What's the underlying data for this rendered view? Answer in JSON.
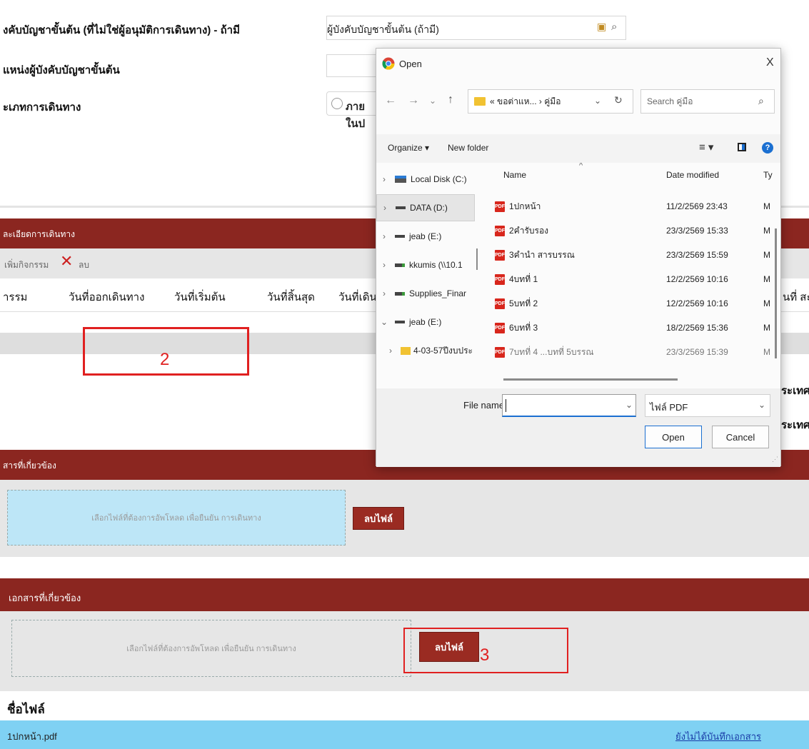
{
  "form": {
    "row1_label": "งคับบัญชาขั้นต้น (ที่ไม่ใช่ผู้อนุมัติการเดินทาง) - ถ้ามี",
    "row1_field": "ผู้บังคับบัญชาขั้นต้น (ถ้ามี)",
    "row2_label": "แหน่งผู้บังคับบัญชาขั้นต้น",
    "row3_label": "ะเภทการเดินทาง",
    "row3_radio": "ภายในป"
  },
  "trip": {
    "header": "ละเอียดการเดินทาง",
    "add_label": "เพิ่มกิจกรรม",
    "delete_label": "ลบ",
    "columns": [
      "ารรม",
      "วันที่ออกเดินทาง",
      "วันที่เริ่มต้น",
      "วันที่สิ้นสุด",
      "วันที่เดินท",
      "นที่ สะ"
    ],
    "right_text_1": "ระเทศ",
    "right_text_2": "ระเทศ"
  },
  "docs1": {
    "header": "สารที่เกี่ยวข้อง",
    "dropzone": "เลือกไฟล์ที่ต้องการอัพโหลด เพื่อยืนยัน การเดินทาง",
    "delete_button": "ลบไฟล์"
  },
  "docs2": {
    "header": "เอกสารที่เกี่ยวข้อง",
    "dropzone": "เลือกไฟล์ที่ต้องการอัพโหลด เพื่อยืนยัน การเดินทาง",
    "delete_button": "ลบไฟล์",
    "file_header": "ชื่อไฟล์",
    "file_name": "1ปกหน้า.pdf",
    "file_status": "ยังไม่ได้บันทึกเอกสาร"
  },
  "annotations": {
    "two": "2",
    "three": "3"
  },
  "dialog": {
    "title": "Open",
    "close": "X",
    "address": "« ขอต่าแห... › คู่มือ",
    "search_placeholder": "Search คู่มือ",
    "organize": "Organize ▾",
    "new_folder": "New folder",
    "nav_items": [
      {
        "label": "Local Disk (C:)",
        "arrow": "›"
      },
      {
        "label": "DATA (D:)",
        "arrow": "›"
      },
      {
        "label": "jeab (E:)",
        "arrow": "›"
      },
      {
        "label": "kkumis (\\\\10.1",
        "arrow": "›"
      },
      {
        "label": "Supplies_Finar",
        "arrow": "›"
      },
      {
        "label": "jeab (E:)",
        "arrow": "⌄"
      },
      {
        "label": "4-03-57ปีงบประ",
        "arrow": "›"
      }
    ],
    "col_name": "Name",
    "col_date": "Date modified",
    "col_type": "Ty",
    "files": [
      {
        "name": "1ปกหน้า",
        "date": "11/2/2569 23:43",
        "type": "M"
      },
      {
        "name": "2คำรับรอง",
        "date": "23/3/2569 15:33",
        "type": "M"
      },
      {
        "name": "3คำนำ สารบรรณ",
        "date": "23/3/2569 15:59",
        "type": "M"
      },
      {
        "name": "4บทที่ 1",
        "date": "12/2/2569 10:16",
        "type": "M"
      },
      {
        "name": "5บทที่ 2",
        "date": "12/2/2569 10:16",
        "type": "M"
      },
      {
        "name": "6บทที่ 3",
        "date": "18/2/2569 15:36",
        "type": "M"
      },
      {
        "name": "7บทที่ 4 ...บทที่ 5บรรณ",
        "date": "23/3/2569 15:39",
        "type": "M"
      }
    ],
    "filename_label": "File name:",
    "filename_value": "",
    "filter": "ไฟล์ PDF",
    "open_button": "Open",
    "cancel_button": "Cancel"
  }
}
